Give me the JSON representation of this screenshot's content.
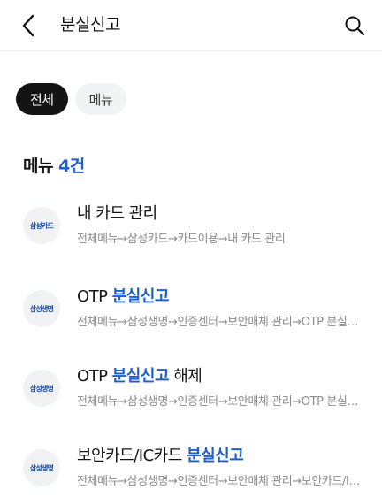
{
  "header": {
    "title": "분실신고",
    "back_icon": "back-chevron-icon",
    "search_icon": "search-icon"
  },
  "tabs": [
    {
      "label": "전체",
      "selected": true
    },
    {
      "label": "메뉴",
      "selected": false
    }
  ],
  "section": {
    "label": "메뉴",
    "count": "4건"
  },
  "results": [
    {
      "badge": "삼성카드",
      "title_pre": "내 카드 관리",
      "title_hl": "",
      "title_post": "",
      "path": "전체메뉴→삼성카드→카드이용→내 카드 관리"
    },
    {
      "badge": "삼성생명",
      "title_pre": "OTP ",
      "title_hl": "분실신고",
      "title_post": "",
      "path": "전체메뉴→삼성생명→인증센터→보안매체 관리→OTP 분실신고"
    },
    {
      "badge": "삼성생명",
      "title_pre": "OTP ",
      "title_hl": "분실신고",
      "title_post": " 해제",
      "path": "전체메뉴→삼성생명→인증센터→보안매체 관리→OTP 분실신고 해제"
    },
    {
      "badge": "삼성생명",
      "title_pre": "보안카드/IC카드 ",
      "title_hl": "분실신고",
      "title_post": "",
      "path": "전체메뉴→삼성생명→인증센터→보안매체 관리→보안카드/IC카드 분실신고"
    }
  ],
  "colors": {
    "accent": "#1b5fd0",
    "tab_active_bg": "#141414",
    "tab_inactive_bg": "#f2f3f5",
    "badge_bg": "#f1f2f4",
    "badge_text": "#1b4fa8",
    "path_text": "#8c8c8c"
  }
}
